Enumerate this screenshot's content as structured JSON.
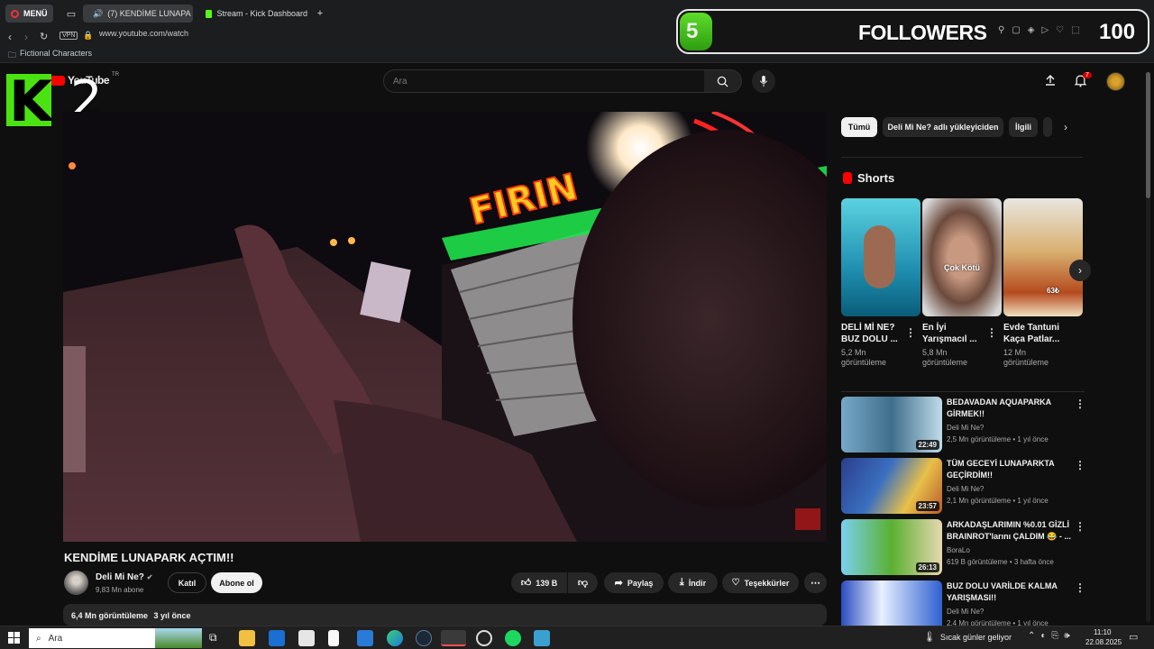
{
  "browser": {
    "menu_label": "MENÜ",
    "tab_youtube": "(7) KENDİME LUNAPA",
    "tab_kick": "Stream - Kick Dashboard",
    "vpn_label": "VPN",
    "url": "www.youtube.com/watch",
    "bookmark": "Fictional Characters"
  },
  "overlay": {
    "followers_count": "5",
    "followers_label": "FOLLOWERS",
    "followers_goal": "100",
    "kick_letter": "K",
    "kick_number": "2"
  },
  "youtube": {
    "logo_text": "YouTube",
    "region": "TR",
    "search_placeholder": "Ara",
    "notification_count": "7"
  },
  "video": {
    "title": "KENDİME LUNAPARK AÇTIM!!",
    "channel": "Deli Mi Ne?",
    "subscribers": "9,83 Mn abone",
    "join_label": "Katıl",
    "subscribe_label": "Abone ol",
    "likes": "139 B",
    "share_label": "Paylaş",
    "download_label": "İndir",
    "thanks_label": "Teşekkürler",
    "views": "6,4 Mn görüntüleme",
    "age": "3 yıl önce",
    "sign_text": "FIRIN"
  },
  "chips": [
    "Tümü",
    "Deli Mi Ne? adlı yükleyiciden",
    "İlgili"
  ],
  "shorts": {
    "header": "Shorts",
    "items": [
      {
        "title": "DELİ Mİ NE? BUZ DOLU ...",
        "views": "5,2 Mn",
        "views_unit": "görüntüleme",
        "overlay": ""
      },
      {
        "title": "En İyi Yarışmacıl ...",
        "views": "5,8 Mn",
        "views_unit": "görüntüleme",
        "overlay": "Çok Kötü"
      },
      {
        "title": "Evde Tantuni Kaça Patlar...",
        "views": "12 Mn",
        "views_unit": "görüntüleme",
        "overlay": "63₺"
      }
    ]
  },
  "recommended": [
    {
      "title1": "BEDAVADAN AQUAPARKA",
      "title2": "GİRMEK!!",
      "channel": "Deli Mi Ne?",
      "meta": "2,5 Mn görüntüleme • 1 yıl önce",
      "duration": "22:49"
    },
    {
      "title1": "TÜM GECEYİ LUNAPARKTA",
      "title2": "GEÇİRDİM!!",
      "channel": "Deli Mi Ne?",
      "meta": "2,1 Mn görüntüleme • 1 yıl önce",
      "duration": "23:57"
    },
    {
      "title1": "ARKADAŞLARIMIN %0.01 GİZLİ",
      "title2": "BRAINROT'larını ÇALDIM 😂 - ...",
      "channel": "BoraLo",
      "meta": "619 B görüntüleme • 3 hafta önce",
      "duration": "26:13"
    },
    {
      "title1": "BUZ DOLU VARİLDE KALMA",
      "title2": "YARIŞMASI!!",
      "channel": "Deli Mi Ne?",
      "meta": "2,4 Mn görüntüleme • 1 yıl önce",
      "duration": ""
    }
  ],
  "taskbar": {
    "search": "Ara",
    "weather": "Sıcak günler geliyor",
    "time": "11:10",
    "date": "22.08.2025"
  }
}
